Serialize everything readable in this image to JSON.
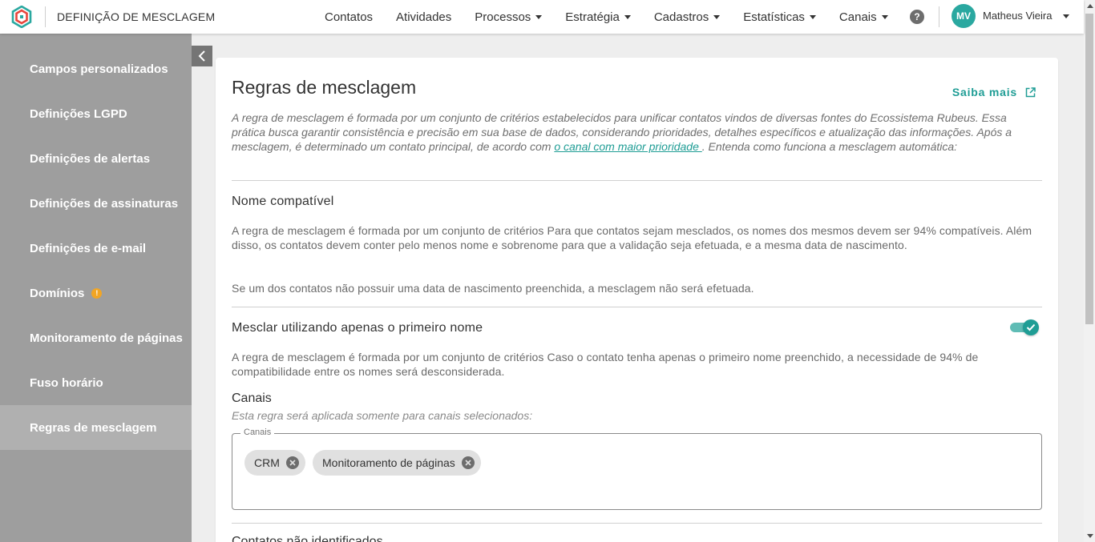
{
  "header": {
    "app_title": "DEFINIÇÃO DE MESCLAGEM",
    "nav": [
      {
        "label": "Contatos",
        "dropdown": false
      },
      {
        "label": "Atividades",
        "dropdown": false
      },
      {
        "label": "Processos",
        "dropdown": true
      },
      {
        "label": "Estratégia",
        "dropdown": true
      },
      {
        "label": "Cadastros",
        "dropdown": true
      },
      {
        "label": "Estatísticas",
        "dropdown": true
      },
      {
        "label": "Canais",
        "dropdown": true
      }
    ],
    "help_icon": "question-circle-icon",
    "help_glyph": "?",
    "user": {
      "initials": "MV",
      "name": "Matheus Vieira"
    },
    "accent_color": "#2aa8a0"
  },
  "sidebar": {
    "items": [
      {
        "label": "Campos personalizados"
      },
      {
        "label": "Definições LGPD"
      },
      {
        "label": "Definições de alertas"
      },
      {
        "label": "Definições de assinaturas"
      },
      {
        "label": "Definições de e-mail"
      },
      {
        "label": "Domínios",
        "warning": "!"
      },
      {
        "label": "Monitoramento de páginas"
      },
      {
        "label": "Fuso horário"
      },
      {
        "label": "Regras de mesclagem",
        "active": true
      }
    ]
  },
  "main": {
    "title": "Regras de mesclagem",
    "learn_more": "Saiba mais",
    "intro_before_link": "A regra de mesclagem é formada por um conjunto de critérios estabelecidos para unificar contatos vindos de diversas fontes do Ecossistema Rubeus. Essa prática busca garantir consistência e precisão em sua base de dados, considerando prioridades, detalhes específicos e atualização das informações. Após a mesclagem, é determinado um contato principal, de acordo com ",
    "intro_link": "o canal com maior prioridade ",
    "intro_after_link": ". Entenda como funciona a mesclagem automática:",
    "sections": {
      "nome_compativel": {
        "title": "Nome compatível",
        "paragraph_1": "A regra de mesclagem é formada por um conjunto de critérios Para que contatos sejam mesclados, os nomes dos mesmos devem ser 94% compatíveis. Além disso, os contatos devem conter pelo menos nome e sobrenome para que a validação seja efetuada, e a mesma data de nascimento.",
        "paragraph_2": "Se um dos contatos não possuir uma data de nascimento preenchida, a mesclagem não será efetuada."
      },
      "primeiro_nome": {
        "title": "Mesclar utilizando apenas o primeiro nome",
        "toggle_on": true,
        "paragraph": "A regra de mesclagem é formada por um conjunto de critérios Caso o contato tenha apenas o primeiro nome preenchido, a necessidade de 94% de compatibilidade entre os nomes será desconsiderada."
      },
      "canais": {
        "title": "Canais",
        "subtitle": "Esta regra será aplicada somente para canais selecionados:",
        "field_label": "Canais",
        "chips": [
          "CRM",
          "Monitoramento de páginas"
        ]
      },
      "next_title": "Contatos não identificados"
    }
  }
}
